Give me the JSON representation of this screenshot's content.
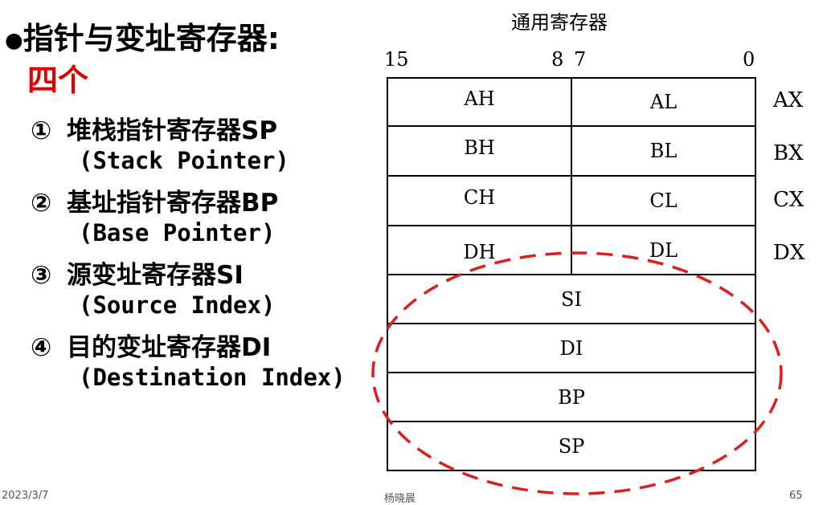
{
  "slide": {
    "bullet": "●",
    "heading_line1": "指针与变址寄存器:",
    "heading_line2": "四个",
    "items": [
      {
        "num": "①",
        "label": "堆栈指针寄存器SP",
        "sub": "(Stack Pointer)"
      },
      {
        "num": "②",
        "label": "基址指针寄存器BP",
        "sub": "(Base Pointer)"
      },
      {
        "num": "③",
        "label": "源变址寄存器SI",
        "sub": "(Source Index)"
      },
      {
        "num": "④",
        "label": "目的变址寄存器DI",
        "sub": "(Destination Index)"
      }
    ],
    "footer_date": "2023/3/7",
    "footer_author": "杨晓晨",
    "page_number": "65",
    "colors": {
      "accent_red": "#e00000",
      "oval_red": "#dd1e1e"
    }
  },
  "diagram": {
    "title": "通用寄存器",
    "bits": {
      "b15": "15",
      "b8": "8",
      "b7": "7",
      "b0": "0"
    },
    "rows": [
      {
        "high": "AH",
        "low": "AL",
        "reg": "AX"
      },
      {
        "high": "BH",
        "low": "BL",
        "reg": "BX"
      },
      {
        "high": "CH",
        "low": "CL",
        "reg": "CX"
      },
      {
        "high": "DH",
        "low": "DL",
        "reg": "DX"
      }
    ],
    "full_rows": [
      "SI",
      "DI",
      "BP",
      "SP"
    ]
  }
}
